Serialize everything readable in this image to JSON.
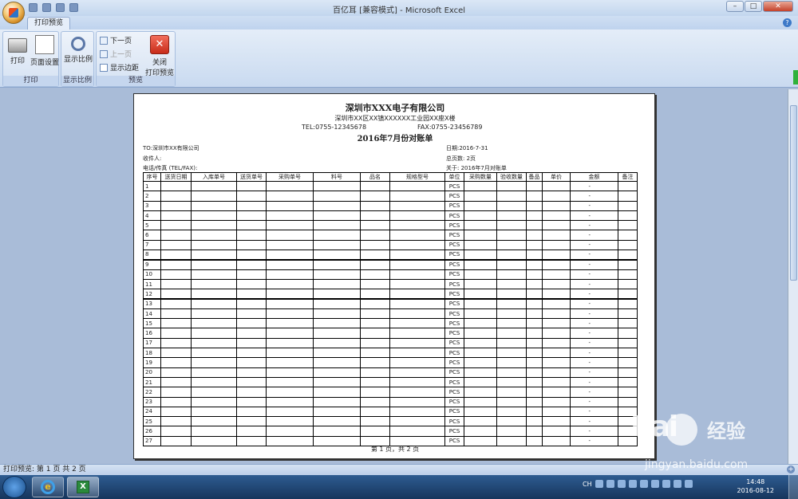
{
  "window": {
    "title": "百亿耳  [兼容模式] - Microsoft Excel",
    "controls": [
      "–",
      "□",
      "✕"
    ]
  },
  "ribbon": {
    "tab": "打印预览",
    "groups": {
      "print": {
        "caption": "打印",
        "print_label": "打印",
        "setup_label": "页面设置"
      },
      "zoom": {
        "caption": "显示比例",
        "zoom_label": "显示比例"
      },
      "preview": {
        "caption": "预览",
        "next_label": "下一页",
        "prev_label": "上一页",
        "margins_label": "显示边距",
        "close_label_1": "关闭",
        "close_label_2": "打印预览"
      }
    }
  },
  "sheet": {
    "company": "深圳市XXX电子有限公司",
    "address": "深圳市XX区XX镇XXXXXX工业园XX座X楼",
    "tel": "TEL:0755-12345678",
    "fax": "FAX:0755-23456789",
    "title": "2016年7月份对账单",
    "to": "TO:深圳市XX有限公司",
    "recipient": "收件人:",
    "phone_fax": "电话/传真 (TEL/FAX):",
    "date": "日期:2016-7-31",
    "total_pages": "总页数: 2页",
    "about": "关于: 2016年7月对账单",
    "columns": [
      "序号",
      "送货日期",
      "入库单号",
      "送货单号",
      "采购单号",
      "料号",
      "品名",
      "规格型号",
      "单位",
      "采购数量",
      "验收数量",
      "备品",
      "单价",
      "金额",
      "备注"
    ],
    "rows": [
      {
        "no": "1",
        "unit": "PCS",
        "amount": "-"
      },
      {
        "no": "2",
        "unit": "PCS",
        "amount": "-"
      },
      {
        "no": "3",
        "unit": "PCS",
        "amount": "-"
      },
      {
        "no": "4",
        "unit": "PCS",
        "amount": "-"
      },
      {
        "no": "5",
        "unit": "PCS",
        "amount": "-"
      },
      {
        "no": "6",
        "unit": "PCS",
        "amount": "-"
      },
      {
        "no": "7",
        "unit": "PCS",
        "amount": "-"
      },
      {
        "no": "8",
        "unit": "PCS",
        "amount": "-"
      },
      {
        "no": "9",
        "unit": "PCS",
        "amount": "-"
      },
      {
        "no": "10",
        "unit": "PCS",
        "amount": "-"
      },
      {
        "no": "11",
        "unit": "PCS",
        "amount": "-"
      },
      {
        "no": "12",
        "unit": "PCS",
        "amount": "-"
      },
      {
        "no": "13",
        "unit": "PCS",
        "amount": "-"
      },
      {
        "no": "14",
        "unit": "PCS",
        "amount": "-"
      },
      {
        "no": "15",
        "unit": "PCS",
        "amount": "-"
      },
      {
        "no": "16",
        "unit": "PCS",
        "amount": "-"
      },
      {
        "no": "17",
        "unit": "PCS",
        "amount": "-"
      },
      {
        "no": "18",
        "unit": "PCS",
        "amount": "-"
      },
      {
        "no": "19",
        "unit": "PCS",
        "amount": "-"
      },
      {
        "no": "20",
        "unit": "PCS",
        "amount": "-"
      },
      {
        "no": "21",
        "unit": "PCS",
        "amount": "-"
      },
      {
        "no": "22",
        "unit": "PCS",
        "amount": "-"
      },
      {
        "no": "23",
        "unit": "PCS",
        "amount": "-"
      },
      {
        "no": "24",
        "unit": "PCS",
        "amount": "-"
      },
      {
        "no": "25",
        "unit": "PCS",
        "amount": "-"
      },
      {
        "no": "26",
        "unit": "PCS",
        "amount": "-"
      },
      {
        "no": "27",
        "unit": "PCS",
        "amount": "-"
      }
    ],
    "pager": "第 1 页，共 2 页"
  },
  "status": {
    "text": "打印预览: 第 1 页  共 2 页",
    "zoom_plus": "+"
  },
  "taskbar": {
    "lang": "CH",
    "time": "14:48",
    "date": "2016-08-12"
  },
  "watermark": {
    "logo": "Bai",
    "brand": "经验",
    "url": "jingyan.baidu.com"
  }
}
